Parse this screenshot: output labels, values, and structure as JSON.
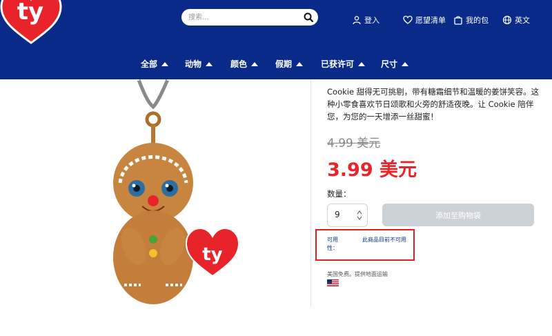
{
  "header": {
    "search": {
      "placeholder": "搜索..."
    },
    "utility": {
      "login": "登入",
      "wishlist": "愿望清单",
      "bag": "我的包",
      "language": "英文"
    },
    "nav": [
      {
        "label": "全部"
      },
      {
        "label": "动物"
      },
      {
        "label": "颜色"
      },
      {
        "label": "假期"
      },
      {
        "label": "已获许可"
      },
      {
        "label": "尺寸"
      }
    ],
    "brand_color": "#0a2a8a"
  },
  "product": {
    "description": "Cookie 甜得无可挑剔，带有糖霜细节和温暖的姜饼笑容。这种小零食喜欢节日颂歌和火旁的舒适夜晚。让 Cookie 陪伴您，为您的一天增添一丝甜蜜！",
    "old_price": "4.99 美元",
    "new_price": "3.99 美元",
    "price_color": "#e8232a",
    "quantity_label": "数量：",
    "quantity_value": "9",
    "add_to_bag": "添加至购物袋",
    "availability_label": "可用性：",
    "availability_status": "此商品目前不可用",
    "shipping": "美国免费。提供地面运输"
  }
}
